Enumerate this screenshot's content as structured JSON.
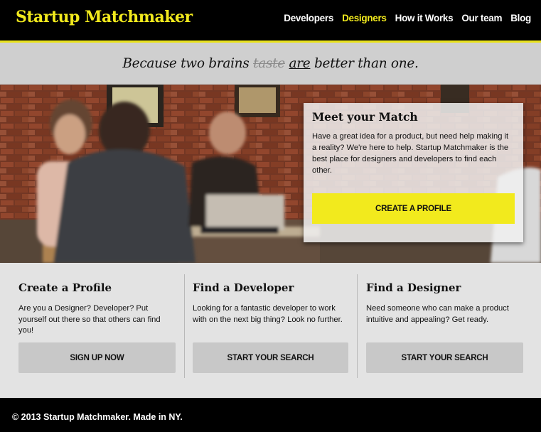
{
  "header": {
    "logo": "Startup Matchmaker",
    "nav": [
      {
        "label": "Developers"
      },
      {
        "label": "Designers"
      },
      {
        "label": "How it Works"
      },
      {
        "label": "Our team"
      },
      {
        "label": "Blog"
      }
    ],
    "active_nav": "Designers"
  },
  "tagline": {
    "before": "Because two brains ",
    "struck": "taste",
    "underlined": "are",
    "after": " better than one."
  },
  "hero": {
    "card_title": "Meet your Match",
    "card_text": "Have a great idea for a product, but need help making it a reality? We're here to help. Startup Matchmaker is the best place for designers and developers to find each other.",
    "cta_label": "CREATE A PROFILE",
    "accent_color": "#f2ea1d"
  },
  "features": [
    {
      "title": "Create a Profile",
      "text": "Are you a Designer? Developer? Put yourself out there so that others can find you!",
      "button": "SIGN UP NOW"
    },
    {
      "title": "Find a Developer",
      "text": "Looking for a fantastic developer to work with on the next big thing? Look no further.",
      "button": "START YOUR SEARCH"
    },
    {
      "title": "Find a Designer",
      "text": "Need someone who can make a product intuitive and appealing? Get ready.",
      "button": "START YOUR SEARCH"
    }
  ],
  "footer": {
    "text": "© 2013 Startup Matchmaker. Made in NY."
  }
}
